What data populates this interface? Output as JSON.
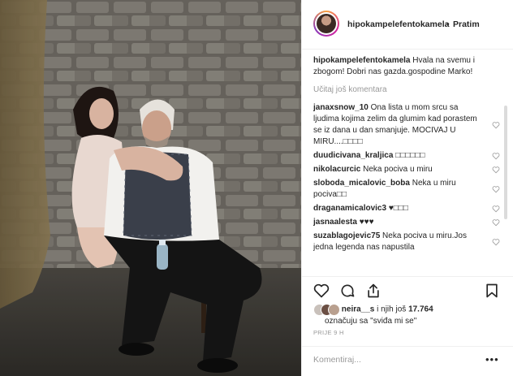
{
  "post": {
    "username": "hipokampelefentokamela",
    "separator": "•",
    "follow_label": "Pratim",
    "caption_user": "hipokampelefentokamela",
    "caption_text": "Hvala na svemu i zbogom! Dobri nas gazda.gospodine Marko!",
    "load_more_label": "Učitaj još komentara"
  },
  "comments": [
    {
      "user": "janaxsnow_10",
      "text": "Ona lista u mom srcu sa ljudima kojima zelim da glumim kad porastem se iz dana u dan smanjuje. MOCIVAJ U MIRU....□□□□"
    },
    {
      "user": "duudicivana_kraljica",
      "text": "□□□□□□"
    },
    {
      "user": "nikolacurcic",
      "text": "Neka pociva u miru"
    },
    {
      "user": "sloboda_micalovic_boba",
      "text": "Neka u miru pociva□□"
    },
    {
      "user": "draganamicalovic3",
      "text": "♥□□□"
    },
    {
      "user": "jasnaalesta",
      "text": "♥♥♥"
    },
    {
      "user": "suzablagojevic75",
      "text": "Neka pociva u miru.Jos jedna legenda nas napustila"
    }
  ],
  "likes": {
    "user": "neira__s",
    "text": " i njih još ",
    "count": "17.764",
    "line2": "označuju sa \"sviđa mi se\""
  },
  "time_label": "PRIJE 9 H",
  "comment_placeholder": "Komentiraj...",
  "more_label": "•••",
  "icons": {
    "like": "heart-icon",
    "comment": "comment-icon",
    "share": "share-icon",
    "save": "bookmark-icon"
  },
  "colors": {
    "text": "#262626",
    "muted": "#999999",
    "border": "#efefef"
  }
}
